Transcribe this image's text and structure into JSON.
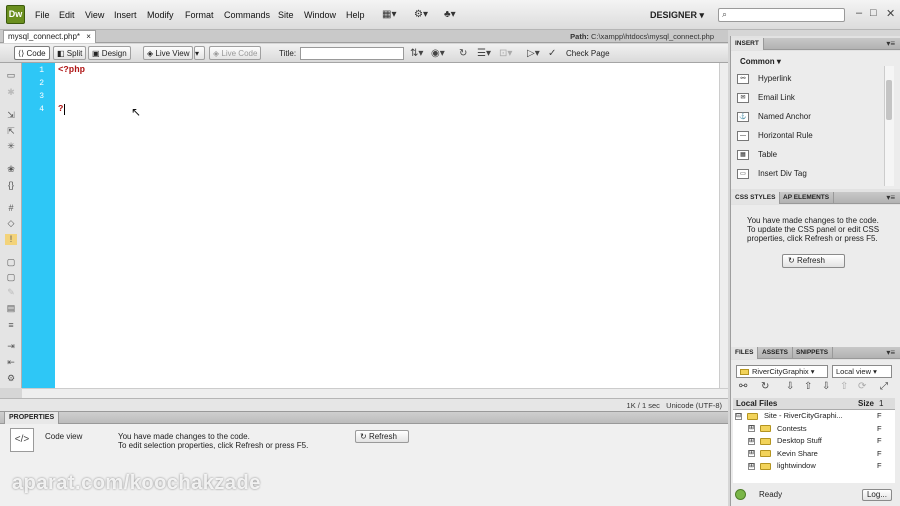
{
  "app": {
    "logo": "Dw",
    "menus": [
      "File",
      "Edit",
      "View",
      "Insert",
      "Modify",
      "Format",
      "Commands",
      "Site",
      "Window",
      "Help"
    ],
    "workspace": "DESIGNER",
    "window_controls": {
      "minimize": "–",
      "maximize": "□",
      "close": "✕"
    }
  },
  "document": {
    "tab_label": "mysql_connect.php*",
    "tab_close": "×",
    "path_label": "Path:",
    "path_value": "C:\\xampp\\htdocs\\mysql_connect.php",
    "views": {
      "code": "Code",
      "split": "Split",
      "design": "Design",
      "live_view": "Live View",
      "live_code": "Live Code"
    },
    "title_label": "Title:",
    "title_value": "",
    "check_page": "Check Page"
  },
  "editor": {
    "line_numbers": [
      "1",
      "2",
      "3",
      "4"
    ],
    "lines": [
      "<?php",
      "",
      "",
      "?"
    ]
  },
  "status": {
    "info": "1K / 1 sec",
    "encoding": "Unicode (UTF-8)"
  },
  "properties": {
    "header": "PROPERTIES",
    "mode": "Code view",
    "message_line1": "You have made changes to the code.",
    "message_line2": "To edit selection properties, click Refresh or press F5.",
    "refresh_label": "Refresh"
  },
  "insert_panel": {
    "tab": "INSERT",
    "category": "Common",
    "items": [
      "Hyperlink",
      "Email Link",
      "Named Anchor",
      "Horizontal Rule",
      "Table",
      "Insert Div Tag"
    ]
  },
  "css_panel": {
    "tabs": [
      "CSS STYLES",
      "AP ELEMENTS"
    ],
    "message_lines": [
      "You have made changes to the code.",
      "To update the CSS panel or edit CSS",
      "properties, click Refresh or press F5."
    ],
    "refresh_label": "Refresh"
  },
  "files_panel": {
    "tabs": [
      "FILES",
      "ASSETS",
      "SNIPPETS"
    ],
    "site_select": "RiverCityGraphix",
    "view_select": "Local view",
    "list_header": "Local Files",
    "size_header": "Size",
    "size_header_extra": "1",
    "rows": [
      {
        "label": "Site - RiverCityGraphi...",
        "toggle": "⊟",
        "size": "F"
      },
      {
        "label": "Contests",
        "toggle": "⊞",
        "size": "F"
      },
      {
        "label": "Desktop Stuff",
        "toggle": "⊞",
        "size": "F"
      },
      {
        "label": "Kevin Share",
        "toggle": "⊞",
        "size": "F"
      },
      {
        "label": "lightwindow",
        "toggle": "⊞",
        "size": "F"
      }
    ],
    "status": "Ready",
    "log_button": "Log..."
  },
  "watermark": "aparat.com/koochakzade",
  "colors": {
    "gutter": "#2ec7f6",
    "code_text": "#b01818",
    "logo": "#6b8f1f"
  }
}
